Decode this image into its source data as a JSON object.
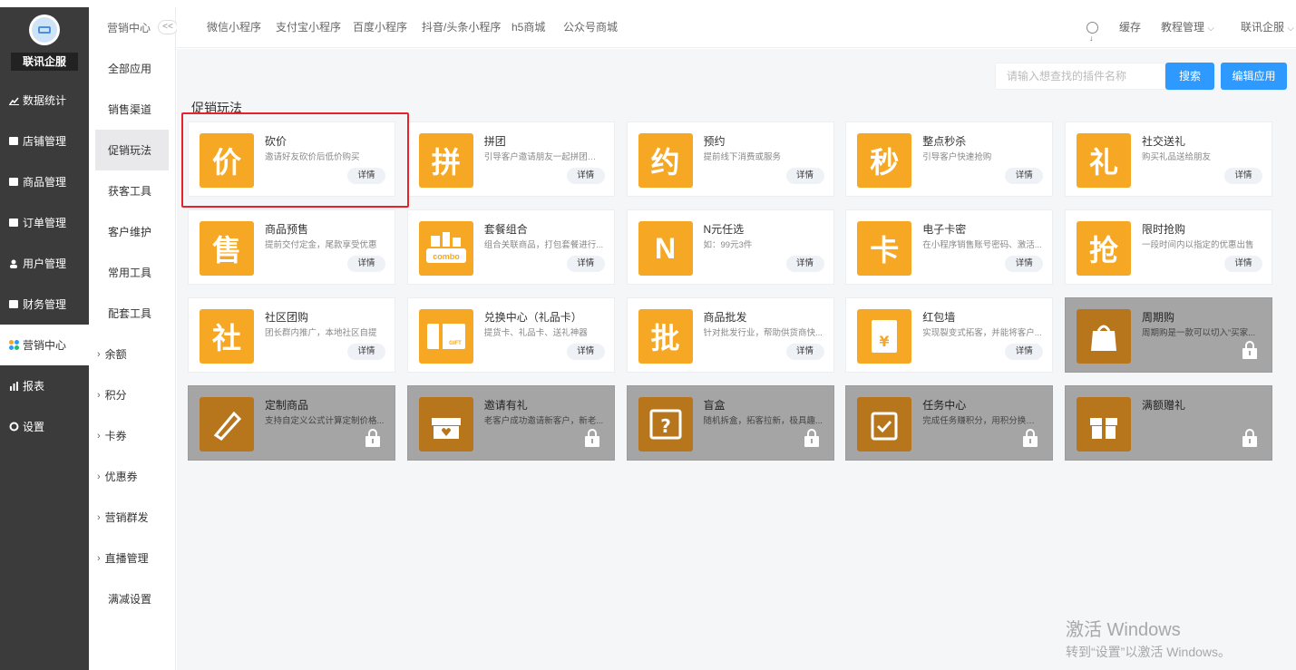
{
  "brand": {
    "name": "联讯企服"
  },
  "sidebar": {
    "items": [
      {
        "label": "数据统计",
        "icon": "chart-icon"
      },
      {
        "label": "店铺管理",
        "icon": "shop-icon"
      },
      {
        "label": "商品管理",
        "icon": "product-icon"
      },
      {
        "label": "订单管理",
        "icon": "order-icon"
      },
      {
        "label": "用户管理",
        "icon": "user-icon"
      },
      {
        "label": "财务管理",
        "icon": "finance-icon"
      },
      {
        "label": "营销中心",
        "icon": "marketing-icon",
        "active": true
      },
      {
        "label": "报表",
        "icon": "report-icon"
      },
      {
        "label": "设置",
        "icon": "settings-icon"
      }
    ]
  },
  "subnav": {
    "header": "营销中心",
    "collapse": "<<",
    "items": [
      {
        "label": "全部应用"
      },
      {
        "label": "销售渠道"
      },
      {
        "label": "促销玩法",
        "active": true
      },
      {
        "label": "获客工具"
      },
      {
        "label": "客户维护"
      },
      {
        "label": "常用工具"
      },
      {
        "label": "配套工具"
      },
      {
        "label": "余额",
        "expandable": true
      },
      {
        "label": "积分",
        "expandable": true
      },
      {
        "label": "卡券",
        "expandable": true
      },
      {
        "label": "优惠券",
        "expandable": true
      },
      {
        "label": "营销群发",
        "expandable": true
      },
      {
        "label": "直播管理",
        "expandable": true
      },
      {
        "label": "满减设置"
      }
    ]
  },
  "topbar": {
    "tabs": [
      "微信小程序",
      "支付宝小程序",
      "百度小程序",
      "抖音/头条小程序",
      "h5商城",
      "公众号商城"
    ],
    "cache": "缓存",
    "tutorial": "教程管理",
    "account": "联讯企服"
  },
  "search": {
    "placeholder": "请输入想查找的插件名称",
    "button": "搜索",
    "edit_button": "编辑应用"
  },
  "section": {
    "title": "促销玩法"
  },
  "detail_label": "详情",
  "colors": {
    "accent": "#f6a723",
    "locked_icon": "#b7751c",
    "locked_card": "#a5a5a5",
    "primary": "#2e99ff",
    "highlight": "#e9212a"
  },
  "cards": [
    {
      "title": "砍价",
      "desc": "邀请好友砍价后低价购买",
      "glyph": "价",
      "locked": false
    },
    {
      "title": "拼团",
      "desc": "引导客户邀请朋友一起拼团购买",
      "glyph": "拼",
      "locked": false
    },
    {
      "title": "预约",
      "desc": "提前线下消费或服务",
      "glyph": "约",
      "locked": false
    },
    {
      "title": "整点秒杀",
      "desc": "引导客户快速抢购",
      "glyph": "秒",
      "locked": false
    },
    {
      "title": "社交送礼",
      "desc": "购买礼品送给朋友",
      "glyph": "礼",
      "locked": false
    },
    {
      "title": "商品预售",
      "desc": "提前交付定金，尾款享受优惠",
      "glyph": "售",
      "locked": false
    },
    {
      "title": "套餐组合",
      "desc": "组合关联商品，打包套餐进行...",
      "glyph": "combo",
      "locked": false
    },
    {
      "title": "N元任选",
      "desc": "如：99元3件",
      "glyph": "N",
      "locked": false
    },
    {
      "title": "电子卡密",
      "desc": "在小程序销售账号密码、激活...",
      "glyph": "卡",
      "locked": false
    },
    {
      "title": "限时抢购",
      "desc": "一段时间内以指定的优惠出售",
      "glyph": "抢",
      "locked": false
    },
    {
      "title": "社区团购",
      "desc": "团长群内推广，本地社区自提",
      "glyph": "社",
      "locked": false
    },
    {
      "title": "兑换中心（礼品卡）",
      "desc": "提货卡、礼品卡、送礼神器",
      "glyph": "GIFT",
      "locked": false
    },
    {
      "title": "商品批发",
      "desc": "针对批发行业，帮助供货商快...",
      "glyph": "批",
      "locked": false
    },
    {
      "title": "红包墙",
      "desc": "实现裂变式拓客，并能将客户...",
      "glyph": "¥",
      "locked": false
    },
    {
      "title": "周期购",
      "desc": "周期购是一款可以切入“买家...",
      "glyph": "周",
      "locked": true
    },
    {
      "title": "定制商品",
      "desc": "支持自定义公式计算定制价格...",
      "glyph": "定",
      "locked": true
    },
    {
      "title": "邀请有礼",
      "desc": "老客户成功邀请新客户，新老...",
      "glyph": "邀",
      "locked": true
    },
    {
      "title": "盲盒",
      "desc": "随机拆盒，拓客拉新，极具趣...",
      "glyph": "?",
      "locked": true
    },
    {
      "title": "任务中心",
      "desc": "完成任务赚积分，用积分换商品",
      "glyph": "任",
      "locked": true
    },
    {
      "title": "满额赠礼",
      "desc": "",
      "glyph": "赠",
      "locked": true
    }
  ],
  "watermark": {
    "line1": "激活 Windows",
    "line2": "转到“设置”以激活 Windows。"
  }
}
